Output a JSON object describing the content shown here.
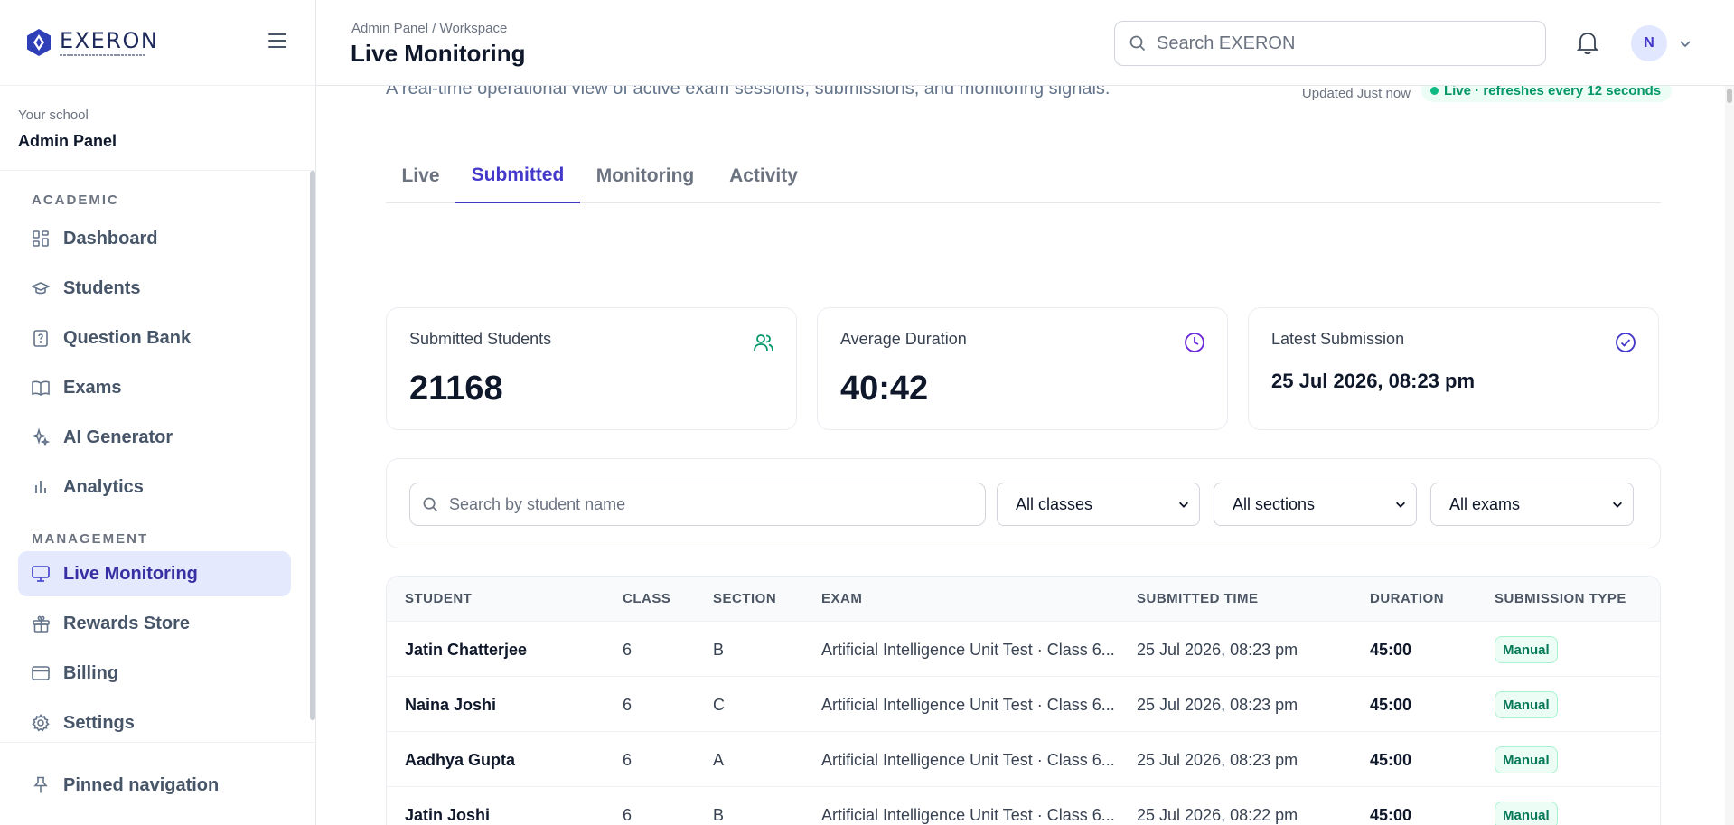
{
  "brand": {
    "name": "EXERON"
  },
  "sidebar": {
    "school_label": "Your school",
    "school_name": "Admin Panel",
    "groups": [
      {
        "title": "ACADEMIC",
        "items": [
          {
            "label": "Dashboard",
            "icon": "grid-icon"
          },
          {
            "label": "Students",
            "icon": "graduation-cap-icon"
          },
          {
            "label": "Question Bank",
            "icon": "help-file-icon"
          },
          {
            "label": "Exams",
            "icon": "book-open-icon"
          },
          {
            "label": "AI Generator",
            "icon": "sparkle-icon"
          },
          {
            "label": "Analytics",
            "icon": "bar-chart-icon"
          }
        ]
      },
      {
        "title": "MANAGEMENT",
        "items": [
          {
            "label": "Live Monitoring",
            "icon": "monitor-icon",
            "active": true
          },
          {
            "label": "Rewards Store",
            "icon": "gift-icon"
          },
          {
            "label": "Billing",
            "icon": "credit-card-icon"
          },
          {
            "label": "Settings",
            "icon": "gear-icon"
          }
        ]
      }
    ],
    "pinned_label": "Pinned navigation"
  },
  "header": {
    "breadcrumb": "Admin Panel / Workspace",
    "title": "Live Monitoring",
    "search_placeholder": "Search EXERON",
    "avatar_initial": "N"
  },
  "main": {
    "description": "A real-time operational view of active exam sessions, submissions, and monitoring signals.",
    "updated": "Updated Just now",
    "live_status": "Live · refreshes every 12 seconds",
    "tabs": [
      {
        "label": "Live"
      },
      {
        "label": "Submitted",
        "active": true
      },
      {
        "label": "Monitoring"
      },
      {
        "label": "Activity"
      }
    ],
    "cards": [
      {
        "label": "Submitted Students",
        "value": "21168",
        "icon": "users-icon"
      },
      {
        "label": "Average Duration",
        "value": "40:42",
        "icon": "clock-icon"
      },
      {
        "label": "Latest Submission",
        "value": "25 Jul 2026, 08:23 pm",
        "icon": "check-circle-icon"
      }
    ],
    "filters": {
      "search_placeholder": "Search by student name",
      "class_select": "All classes",
      "section_select": "All sections",
      "exam_select": "All exams"
    },
    "table": {
      "headers": [
        "STUDENT",
        "CLASS",
        "SECTION",
        "EXAM",
        "SUBMITTED TIME",
        "DURATION",
        "SUBMISSION TYPE"
      ],
      "rows": [
        {
          "student": "Jatin Chatterjee",
          "class": "6",
          "section": "B",
          "exam": "Artificial Intelligence Unit Test · Class 6...",
          "time": "25 Jul 2026, 08:23 pm",
          "duration": "45:00",
          "type": "Manual"
        },
        {
          "student": "Naina Joshi",
          "class": "6",
          "section": "C",
          "exam": "Artificial Intelligence Unit Test · Class 6...",
          "time": "25 Jul 2026, 08:23 pm",
          "duration": "45:00",
          "type": "Manual"
        },
        {
          "student": "Aadhya Gupta",
          "class": "6",
          "section": "A",
          "exam": "Artificial Intelligence Unit Test · Class 6...",
          "time": "25 Jul 2026, 08:23 pm",
          "duration": "45:00",
          "type": "Manual"
        },
        {
          "student": "Jatin Joshi",
          "class": "6",
          "section": "B",
          "exam": "Artificial Intelligence Unit Test · Class 6...",
          "time": "25 Jul 2026, 08:22 pm",
          "duration": "45:00",
          "type": "Manual"
        }
      ]
    }
  },
  "colors": {
    "accent": "#4338ca",
    "active_bg": "#e5e9fe",
    "success": "#059669"
  }
}
